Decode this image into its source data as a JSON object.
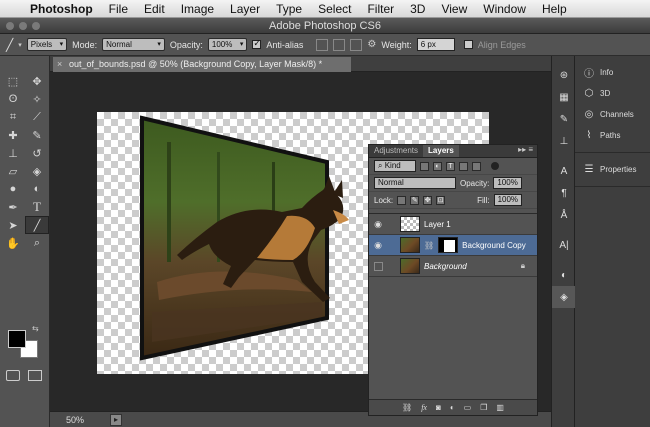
{
  "menubar": {
    "app_name": "Photoshop",
    "items": [
      "File",
      "Edit",
      "Image",
      "Layer",
      "Type",
      "Select",
      "Filter",
      "3D",
      "View",
      "Window",
      "Help"
    ]
  },
  "window": {
    "title": "Adobe Photoshop CS6"
  },
  "options_bar": {
    "tool_icon": "line-tool-icon",
    "mode_prefix_value": "Pixels",
    "mode_label": "Mode:",
    "mode_value": "Normal",
    "opacity_label": "Opacity:",
    "opacity_value": "100%",
    "antialias_label": "Anti-alias",
    "antialias_checked": true,
    "weight_label": "Weight:",
    "weight_value": "6 px",
    "align_edges_label": "Align Edges",
    "align_edges_checked": false
  },
  "document": {
    "tab_label": "out_of_bounds.psd @ 50% (Background Copy, Layer Mask/8) *",
    "zoom": "50%"
  },
  "layers_panel": {
    "tabs": [
      "Adjustments",
      "Layers"
    ],
    "active_tab": "Layers",
    "filter_value": "Kind",
    "blend_mode": "Normal",
    "opacity_label": "Opacity:",
    "opacity_value": "100%",
    "lock_label": "Lock:",
    "fill_label": "Fill:",
    "fill_value": "100%",
    "layers": [
      {
        "name": "Layer 1",
        "visible": true,
        "selected": false,
        "has_mask": false,
        "locked": false
      },
      {
        "name": "Background Copy",
        "visible": true,
        "selected": true,
        "has_mask": true,
        "locked": false
      },
      {
        "name": "Background",
        "visible": false,
        "selected": false,
        "has_mask": false,
        "locked": true
      }
    ],
    "footer_icons": [
      "link-icon",
      "fx-icon",
      "mask-icon",
      "adjustment-icon",
      "folder-icon",
      "new-layer-icon",
      "trash-icon"
    ]
  },
  "right_dock": {
    "group1": [
      {
        "label": "Info",
        "icon": "info-icon"
      },
      {
        "label": "3D",
        "icon": "cube-icon"
      },
      {
        "label": "Channels",
        "icon": "channels-icon"
      },
      {
        "label": "Paths",
        "icon": "paths-icon"
      }
    ],
    "group2": [
      {
        "label": "Properties",
        "icon": "properties-icon"
      }
    ]
  },
  "colors": {
    "accent_selected": "#4d6b95",
    "foreground": "#000000",
    "background": "#ffffff"
  }
}
